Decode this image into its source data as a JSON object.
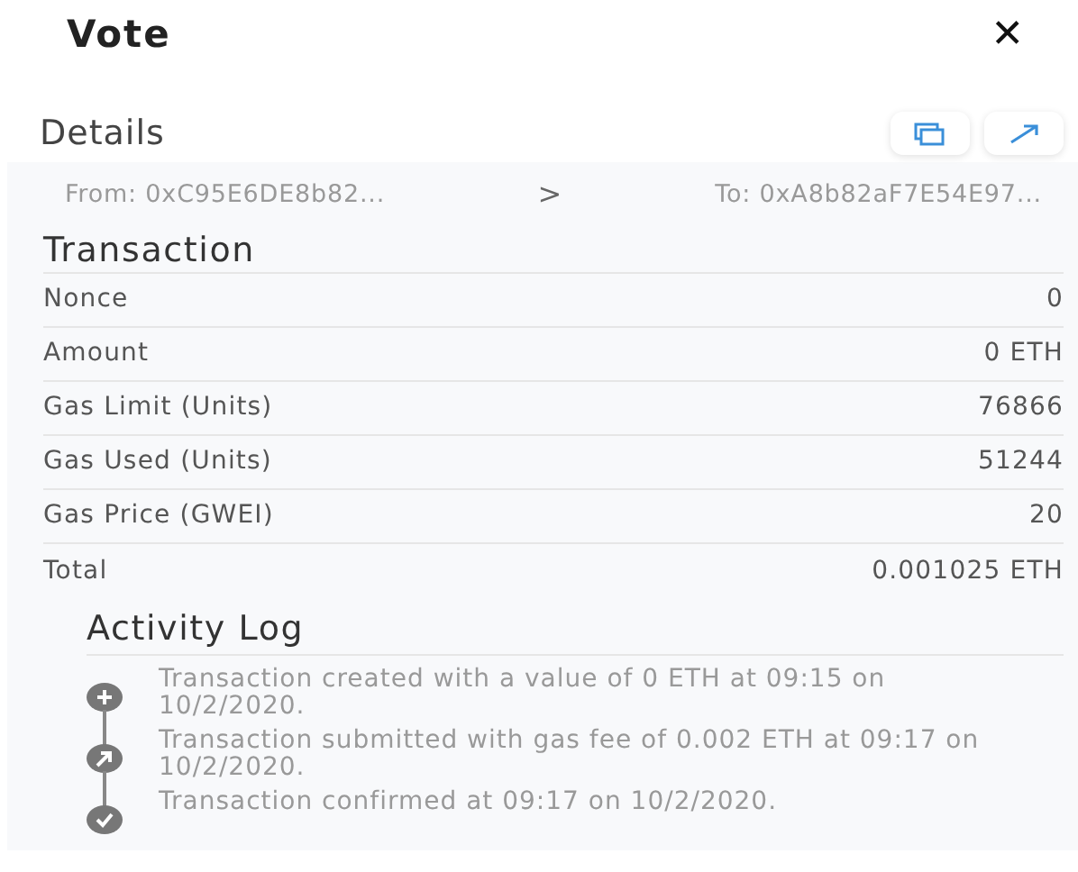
{
  "header": {
    "title": "Vote",
    "close": "✕"
  },
  "details": {
    "title": "Details",
    "from": "From: 0xC95E6DE8b82...",
    "separator": ">",
    "to": "To: 0xA8b82aF7E54E97..."
  },
  "transaction": {
    "title": "Transaction",
    "rows": [
      {
        "label": "Nonce",
        "value": "0"
      },
      {
        "label": "Amount",
        "value": "0 ETH"
      },
      {
        "label": "Gas Limit (Units)",
        "value": "76866"
      },
      {
        "label": "Gas Used (Units)",
        "value": "51244"
      },
      {
        "label": "Gas Price (GWEI)",
        "value": "20"
      },
      {
        "label": "Total",
        "value": "0.001025 ETH"
      }
    ]
  },
  "activity_log": {
    "title": "Activity Log",
    "entries": [
      {
        "kind": "created",
        "text": "Transaction created with a value of 0 ETH at 09:15 on 10/2/2020."
      },
      {
        "kind": "submitted",
        "text": "Transaction submitted with gas fee of 0.002 ETH at 09:17 on 10/2/2020."
      },
      {
        "kind": "confirmed",
        "text": "Transaction confirmed at 09:17 on 10/2/2020."
      }
    ]
  }
}
